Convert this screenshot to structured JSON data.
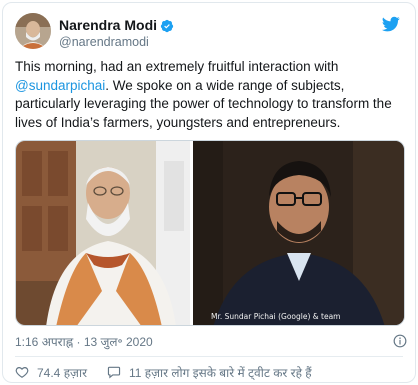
{
  "author": {
    "name": "Narendra Modi",
    "handle": "@narendramodi"
  },
  "tweet": {
    "text_before": "This morning, had an extremely fruitful interaction with ",
    "mention": "@sundarpichai",
    "text_after": ". We spoke on a wide range of subjects, particularly leveraging the power of technology to transform the lives of India’s farmers, youngsters and entrepreneurs."
  },
  "media": {
    "caption": "Mr. Sundar Pichai (Google) & team"
  },
  "meta": {
    "timestamp": "1:16 अपराह्न · 13 जुल॰ 2020"
  },
  "actions": {
    "likes": "74.4 हज़ार",
    "talking": "11 हज़ार लोग इसके बारे में ट्वीट कर रहे हैं"
  },
  "colors": {
    "brand": "#1da1f2",
    "mention": "#1b95e0",
    "secondary": "#657786",
    "like": "#e0245e"
  },
  "icons": [
    "verified-badge-icon",
    "twitter-bird-icon",
    "info-icon",
    "heart-icon",
    "speech-bubble-icon"
  ]
}
